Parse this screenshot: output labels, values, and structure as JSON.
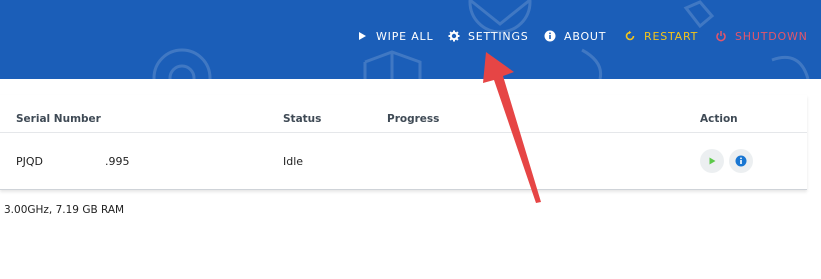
{
  "nav": {
    "wipe_all": "WIPE ALL",
    "settings": "SETTINGS",
    "about": "ABOUT",
    "restart": "RESTART",
    "shutdown": "SHUTDOWN"
  },
  "icons": {
    "wipe_all": "play-icon",
    "settings": "gear-icon",
    "about": "info-icon",
    "restart": "restart-icon",
    "shutdown": "power-icon"
  },
  "table": {
    "headers": [
      "Serial Number",
      "Status",
      "Progress",
      "Action"
    ],
    "rows": [
      {
        "serial_a": "PJQD",
        "serial_b": ".995",
        "status": "Idle",
        "progress": ""
      }
    ]
  },
  "footer": {
    "system_info": "3.00GHz, 7.19 GB RAM"
  },
  "colors": {
    "header_bg": "#1b5eb8",
    "restart": "#f5c518",
    "shutdown": "#e4566a",
    "play": "#5cc94a",
    "info": "#1976d2",
    "annotation_arrow": "#e64545"
  }
}
